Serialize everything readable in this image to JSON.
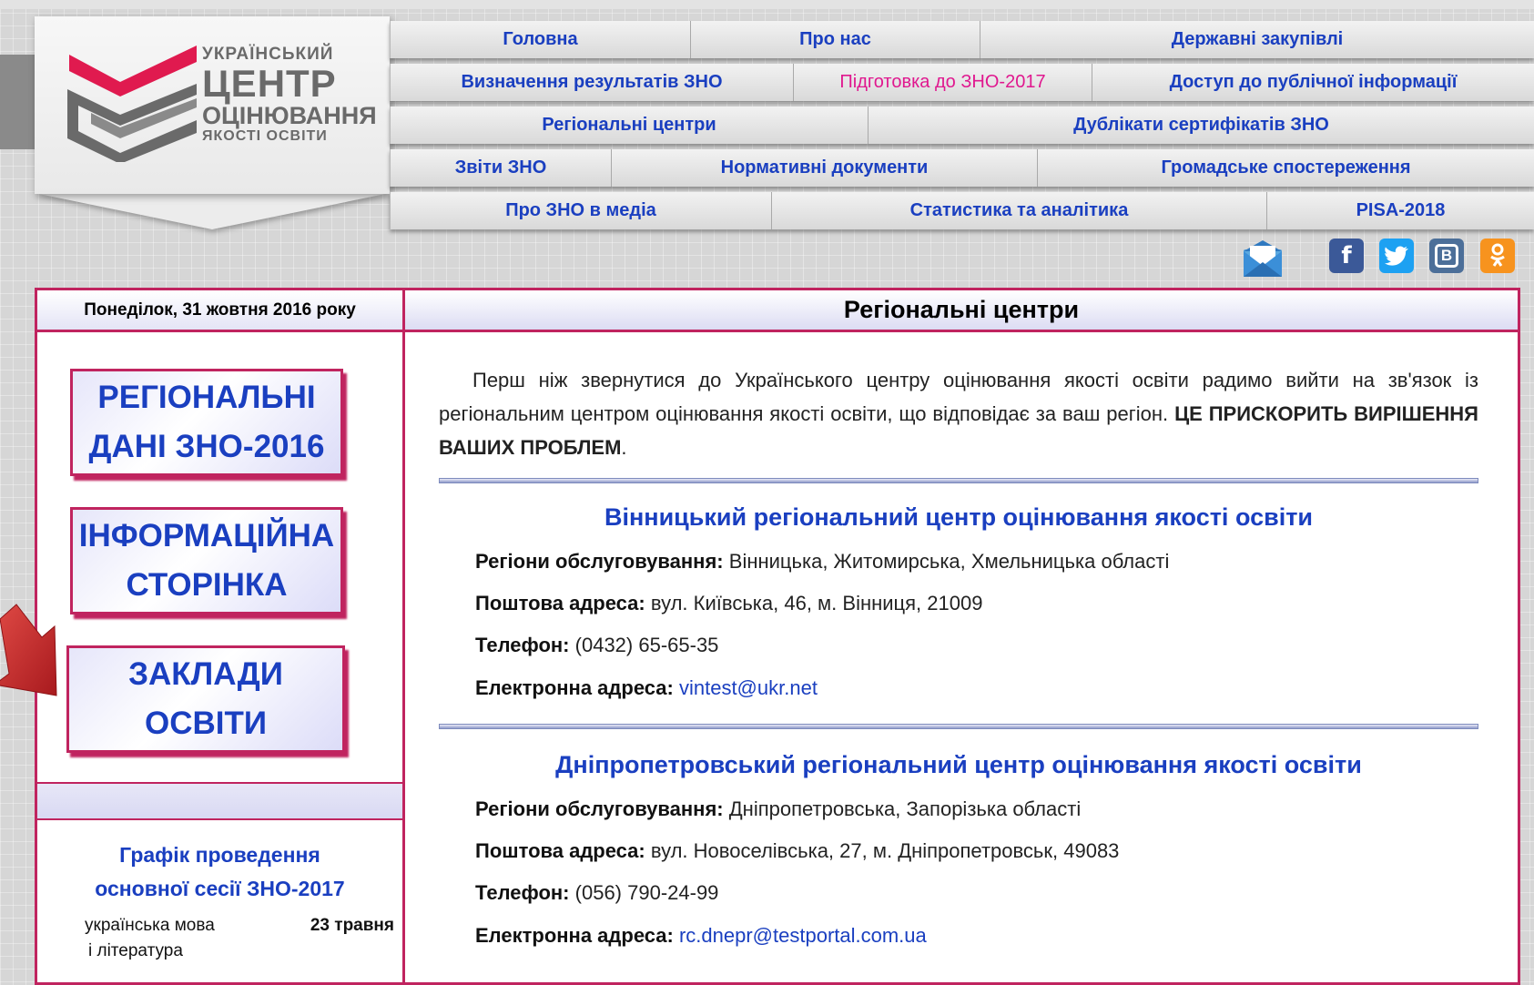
{
  "logo": {
    "line1": "УКРАЇНСЬКИЙ",
    "line2": "ЦЕНТР",
    "line3": "ОЦІНЮВАННЯ",
    "line4": "ЯКОСТІ ОСВІТИ"
  },
  "nav": {
    "row1": [
      "Головна",
      "Про нас",
      "Державні закупівлі"
    ],
    "row2": [
      "Визначення результатів ЗНО",
      "Підготовка до ЗНО-2017",
      "Доступ до публічної інформації"
    ],
    "row3": [
      "Регіональні центри",
      "Дублікати сертифікатів ЗНО"
    ],
    "row4": [
      "Звіти ЗНО",
      "Нормативні документи",
      "Громадське спостереження"
    ],
    "row5": [
      "Про ЗНО в медіа",
      "Статистика та аналітика",
      "PISA-2018"
    ]
  },
  "social": {
    "icons": [
      "mail-icon",
      "facebook-icon",
      "twitter-icon",
      "vkontakte-icon",
      "odnoklassniki-icon"
    ],
    "facebook_glyph": "f",
    "vk_glyph": "В"
  },
  "sidebar": {
    "date": "Понеділок, 31 жовтня 2016 року",
    "btn1": [
      "РЕГІОНАЛЬНІ",
      "ДАНІ ЗНО-2016"
    ],
    "btn2": [
      "ІНФОРМАЦІЙНА",
      "СТОРІНКА"
    ],
    "btn3": [
      "ЗАКЛАДИ",
      "ОСВІТИ"
    ],
    "schedule_title": [
      "Графік проведення",
      "основної сесії ЗНО-2017"
    ],
    "schedule_subject1": "українська мова",
    "schedule_subject2": "і література",
    "schedule_date": "23 травня"
  },
  "main": {
    "title": "Регіональні центри",
    "intro": "Перш ніж звернутися до Українського центру оцінювання якості освіти радимо вийти на зв'язок із регіональним центром оцінювання якості освіти, що відповідає за ваш регіон.",
    "intro_bold": "ЦЕ ПРИСКОРИТЬ ВИРІШЕННЯ ВАШИХ ПРОБЛЕМ",
    "intro_end": ".",
    "labels": {
      "regions": "Регіони обслуговування:",
      "address": "Поштова адреса:",
      "phone": "Телефон:",
      "email": "Електронна адреса:"
    },
    "centers": [
      {
        "name": "Вінницький регіональний центр оцінювання якості освіти",
        "regions": "Вінницька, Житомирська, Хмельницька області",
        "address": "вул. Київська, 46, м. Вінниця, 21009",
        "phone": "(0432) 65-65-35",
        "email": "vintest@ukr.net"
      },
      {
        "name": "Дніпропетровський регіональний центр оцінювання якості освіти",
        "regions": "Дніпропетровська, Запорізька області",
        "address": "вул. Новоселівська, 27, м. Дніпропетровськ, 49083",
        "phone": "(056) 790-24-99",
        "email": "rc.dnepr@testportal.com.ua"
      }
    ]
  },
  "colors": {
    "accent_link": "#1a3fc0",
    "border_crimson": "#c0245f",
    "active_nav_pink": "#e0188f",
    "arrow_red": "#c0292b"
  }
}
